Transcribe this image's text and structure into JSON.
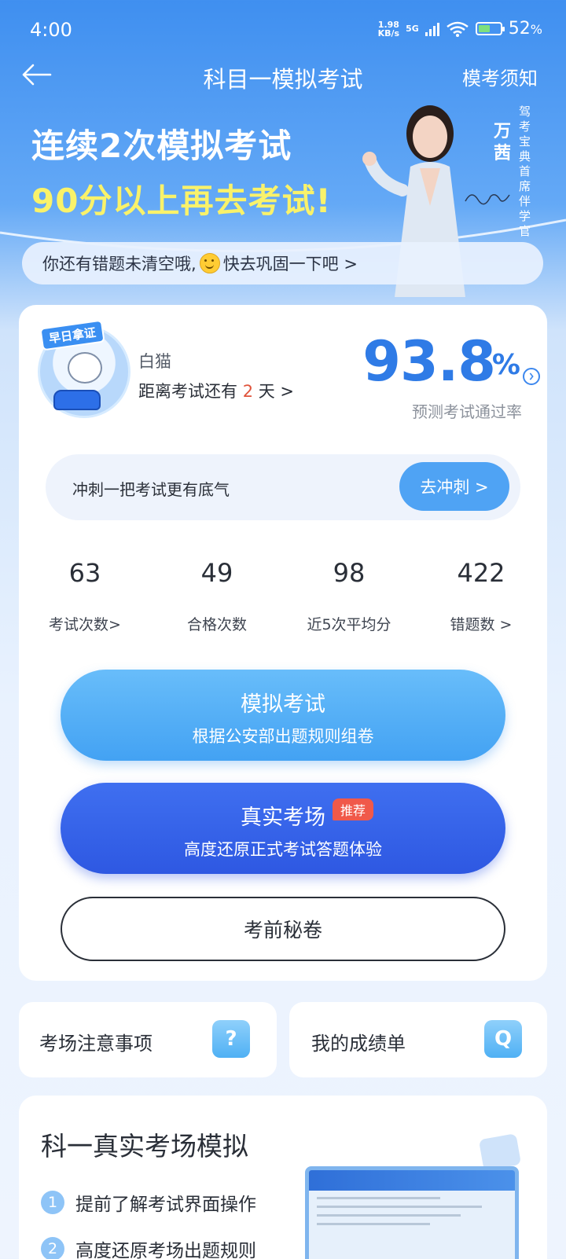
{
  "status": {
    "time": "4:00",
    "net_speed_top": "1.98",
    "net_speed_bottom": "KB/s",
    "network": "5G",
    "battery": "52",
    "battery_unit": "%"
  },
  "nav": {
    "title": "科目一模拟考试",
    "right_link": "模考须知"
  },
  "banner": {
    "line1": "连续2次模拟考试",
    "line2": "90分以上再去考试!",
    "coach_name": "万茜",
    "coach_title": "驾考宝典首席伴学官",
    "tip_before": "你还有错题未清空哦,",
    "tip_after": "快去巩固一下吧 >"
  },
  "profile": {
    "badge": "早日拿证",
    "name": "白猫",
    "countdown_prefix": "距离考试还有 ",
    "countdown_days": "2",
    "countdown_suffix": " 天 >",
    "pass_rate": "93.8",
    "pass_rate_unit": "%",
    "pass_rate_label": "预测考试通过率"
  },
  "sprint": {
    "text": "冲刺一把考试更有底气",
    "button": "去冲刺 >"
  },
  "stats": [
    {
      "value": "63",
      "label": "考试次数>"
    },
    {
      "value": "49",
      "label": "合格次数"
    },
    {
      "value": "98",
      "label": "近5次平均分"
    },
    {
      "value": "422",
      "label": "错题数 >"
    }
  ],
  "actions": {
    "mock_title": "模拟考试",
    "mock_sub": "根据公安部出题规则组卷",
    "real_title": "真实考场",
    "real_badge": "推荐",
    "real_sub": "高度还原正式考试答题体验",
    "secret": "考前秘卷"
  },
  "tiles": [
    {
      "label": "考场注意事项",
      "icon": "question-icon",
      "glyph": "?"
    },
    {
      "label": "我的成绩单",
      "icon": "search-list-icon",
      "glyph": "Q"
    }
  ],
  "section": {
    "title": "科一真实考场模拟",
    "features": [
      {
        "num": "1",
        "text": "提前了解考试界面操作"
      },
      {
        "num": "2",
        "text": "高度还原考场出题规则"
      }
    ]
  }
}
